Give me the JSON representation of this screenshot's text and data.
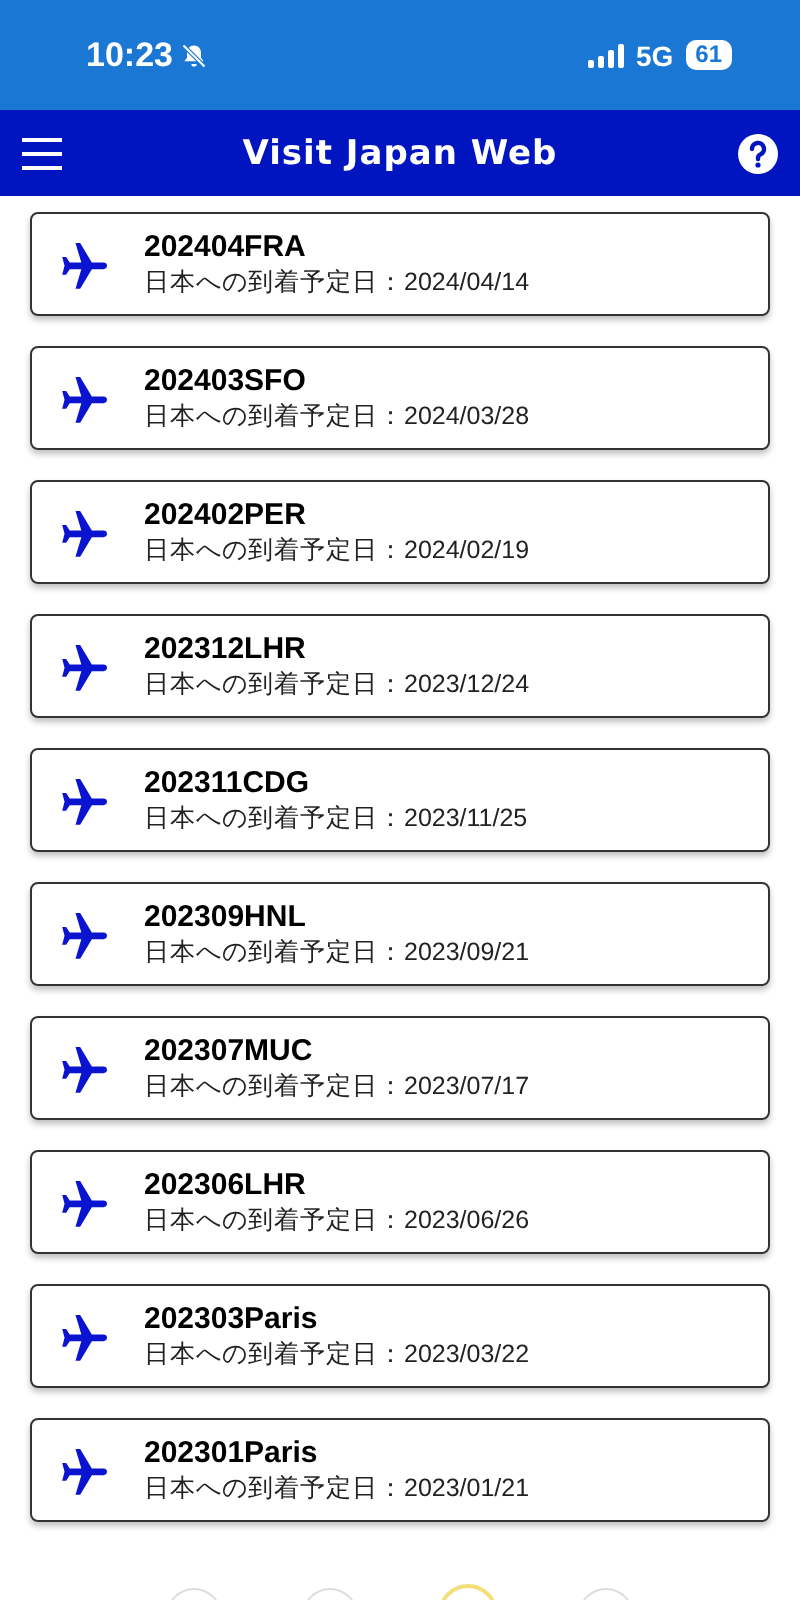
{
  "status_bar": {
    "time": "10:23",
    "silent": true,
    "network": "5G",
    "battery": "61"
  },
  "header": {
    "title": "Visit Japan Web"
  },
  "trips": [
    {
      "name": "202404FRA",
      "arrival": "日本への到着予定日：2024/04/14"
    },
    {
      "name": "202403SFO",
      "arrival": "日本への到着予定日：2024/03/28"
    },
    {
      "name": "202402PER",
      "arrival": "日本への到着予定日：2024/02/19"
    },
    {
      "name": "202312LHR",
      "arrival": "日本への到着予定日：2023/12/24"
    },
    {
      "name": "202311CDG",
      "arrival": "日本への到着予定日：2023/11/25"
    },
    {
      "name": "202309HNL",
      "arrival": "日本への到着予定日：2023/09/21"
    },
    {
      "name": "202307MUC",
      "arrival": "日本への到着予定日：2023/07/17"
    },
    {
      "name": "202306LHR",
      "arrival": "日本への到着予定日：2023/06/26"
    },
    {
      "name": "202303Paris",
      "arrival": "日本への到着予定日：2023/03/22"
    },
    {
      "name": "202301Paris",
      "arrival": "日本への到着予定日：2023/01/21"
    }
  ]
}
